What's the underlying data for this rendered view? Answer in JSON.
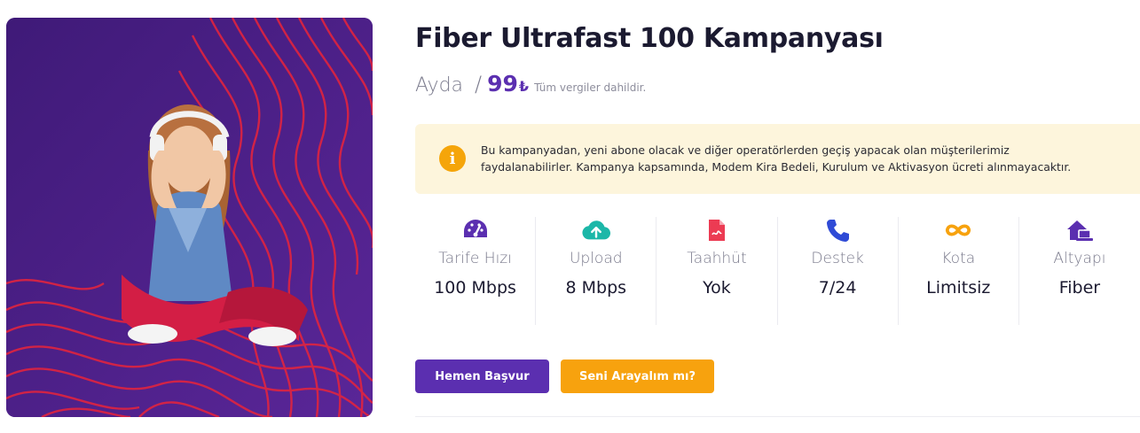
{
  "campaign": {
    "title": "Fiber Ultrafast 100 Kampanyası",
    "price_period": "Ayda",
    "price_separator": "/",
    "price_amount": "99",
    "price_currency": "₺",
    "tax_note": "Tüm vergiler dahildir."
  },
  "notice": {
    "icon": "info-icon",
    "text": "Bu kampanyadan, yeni abone olacak ve diğer operatörlerden geçiş yapacak olan müşterilerimiz faydalanabilirler. Kampanya kapsamında, Modem Kira Bedeli, Kurulum ve Aktivasyon ücreti alınmayacaktır.",
    "background": "#fdf5dc",
    "icon_color": "#f5a50a"
  },
  "features": [
    {
      "icon": "speedometer-icon",
      "label": "Tarife Hızı",
      "value": "100 Mbps",
      "color": "#5b2fb0"
    },
    {
      "icon": "cloud-upload-icon",
      "label": "Upload",
      "value": "8 Mbps",
      "color": "#1cb7a8"
    },
    {
      "icon": "document-icon",
      "label": "Taahhüt",
      "value": "Yok",
      "color": "#ec3b53"
    },
    {
      "icon": "phone-icon",
      "label": "Destek",
      "value": "7/24",
      "color": "#2f4bd6"
    },
    {
      "icon": "infinity-icon",
      "label": "Kota",
      "value": "Limitsiz",
      "color": "#f7a20e"
    },
    {
      "icon": "home-laptop-icon",
      "label": "Altyapı",
      "value": "Fiber",
      "color": "#5b2fb0"
    }
  ],
  "actions": {
    "apply_label": "Hemen Başvur",
    "call_label": "Seni Arayalım mı?",
    "apply_color": "#5b2fb0",
    "call_color": "#f7a20e"
  }
}
